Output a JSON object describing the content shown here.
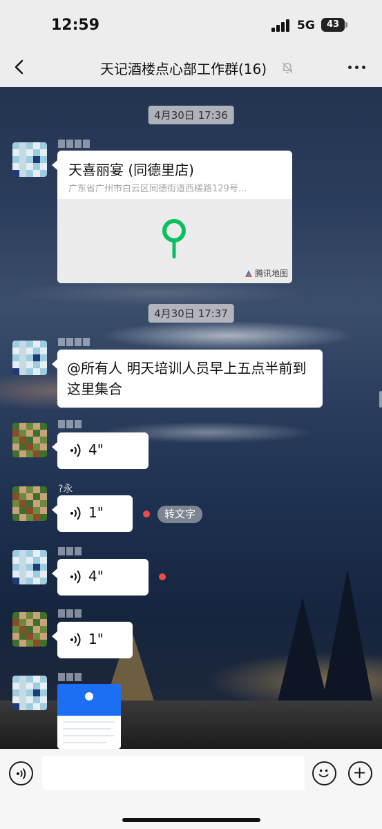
{
  "status_bar": {
    "time": "12:59",
    "network": "5G",
    "battery": "43"
  },
  "nav": {
    "title": "天记酒楼点心部工作群(16)"
  },
  "timestamps": [
    "4月30日 17:36",
    "4月30日 17:37"
  ],
  "messages": {
    "location": {
      "title": "天喜丽宴 (同德里店)",
      "address": "广东省广州市白云区同德街道西槎路129号...",
      "map_brand": "腾讯地图"
    },
    "text": {
      "content": "@所有人 明天培训人员早上五点半前到这里集合"
    },
    "voice": [
      {
        "duration": "4\""
      },
      {
        "sender_fragment": "?永",
        "duration": "1\"",
        "to_text": "转文字"
      },
      {
        "duration": "4\""
      },
      {
        "duration": "1\""
      }
    ]
  },
  "colors": {
    "voice_unread_dot": "#f14a4a",
    "pin_green": "#07c160",
    "image_header_blue": "#1c6ef2"
  }
}
